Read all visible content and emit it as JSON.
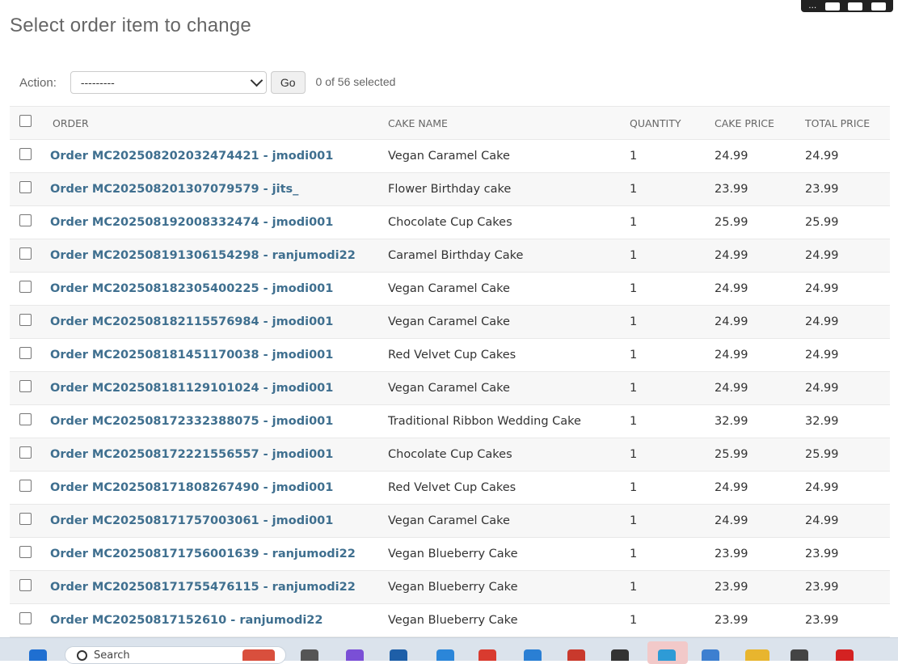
{
  "page": {
    "title": "Select order item to change"
  },
  "actions": {
    "label": "Action:",
    "selected_value": "---------",
    "go_label": "Go",
    "selected_count": "0 of 56 selected"
  },
  "table": {
    "headers": {
      "order": "Order",
      "cake_name": "Cake name",
      "quantity": "Quantity",
      "cake_price": "Cake price",
      "total_price": "Total price"
    },
    "rows": [
      {
        "order": "Order MC202508202032474421 - jmodi001",
        "cake_name": "Vegan Caramel Cake",
        "quantity": "1",
        "cake_price": "24.99",
        "total_price": "24.99"
      },
      {
        "order": "Order MC202508201307079579 - jits_",
        "cake_name": "Flower Birthday cake",
        "quantity": "1",
        "cake_price": "23.99",
        "total_price": "23.99"
      },
      {
        "order": "Order MC202508192008332474 - jmodi001",
        "cake_name": "Chocolate Cup Cakes",
        "quantity": "1",
        "cake_price": "25.99",
        "total_price": "25.99"
      },
      {
        "order": "Order MC202508191306154298 - ranjumodi22",
        "cake_name": "Caramel Birthday Cake",
        "quantity": "1",
        "cake_price": "24.99",
        "total_price": "24.99"
      },
      {
        "order": "Order MC202508182305400225 - jmodi001",
        "cake_name": "Vegan Caramel Cake",
        "quantity": "1",
        "cake_price": "24.99",
        "total_price": "24.99"
      },
      {
        "order": "Order MC202508182115576984 - jmodi001",
        "cake_name": "Vegan Caramel Cake",
        "quantity": "1",
        "cake_price": "24.99",
        "total_price": "24.99"
      },
      {
        "order": "Order MC202508181451170038 - jmodi001",
        "cake_name": "Red Velvet Cup Cakes",
        "quantity": "1",
        "cake_price": "24.99",
        "total_price": "24.99"
      },
      {
        "order": "Order MC202508181129101024 - jmodi001",
        "cake_name": "Vegan Caramel Cake",
        "quantity": "1",
        "cake_price": "24.99",
        "total_price": "24.99"
      },
      {
        "order": "Order MC202508172332388075 - jmodi001",
        "cake_name": "Traditional Ribbon Wedding Cake",
        "quantity": "1",
        "cake_price": "32.99",
        "total_price": "32.99"
      },
      {
        "order": "Order MC202508172221556557 - jmodi001",
        "cake_name": "Chocolate Cup Cakes",
        "quantity": "1",
        "cake_price": "25.99",
        "total_price": "25.99"
      },
      {
        "order": "Order MC202508171808267490 - jmodi001",
        "cake_name": "Red Velvet Cup Cakes",
        "quantity": "1",
        "cake_price": "24.99",
        "total_price": "24.99"
      },
      {
        "order": "Order MC202508171757003061 - jmodi001",
        "cake_name": "Vegan Caramel Cake",
        "quantity": "1",
        "cake_price": "24.99",
        "total_price": "24.99"
      },
      {
        "order": "Order MC202508171756001639 - ranjumodi22",
        "cake_name": "Vegan Blueberry Cake",
        "quantity": "1",
        "cake_price": "23.99",
        "total_price": "23.99"
      },
      {
        "order": "Order MC202508171755476115 - ranjumodi22",
        "cake_name": "Vegan Blueberry Cake",
        "quantity": "1",
        "cake_price": "23.99",
        "total_price": "23.99"
      },
      {
        "order": "Order MC20250817152610 - ranjumodi22",
        "cake_name": "Vegan Blueberry Cake",
        "quantity": "1",
        "cake_price": "23.99",
        "total_price": "23.99"
      }
    ]
  },
  "taskbar": {
    "search_placeholder": "Search"
  },
  "colors": {
    "link": "#3f6f8f",
    "row_alt": "#f7f7f7",
    "header_bg": "#f8f8f8"
  }
}
